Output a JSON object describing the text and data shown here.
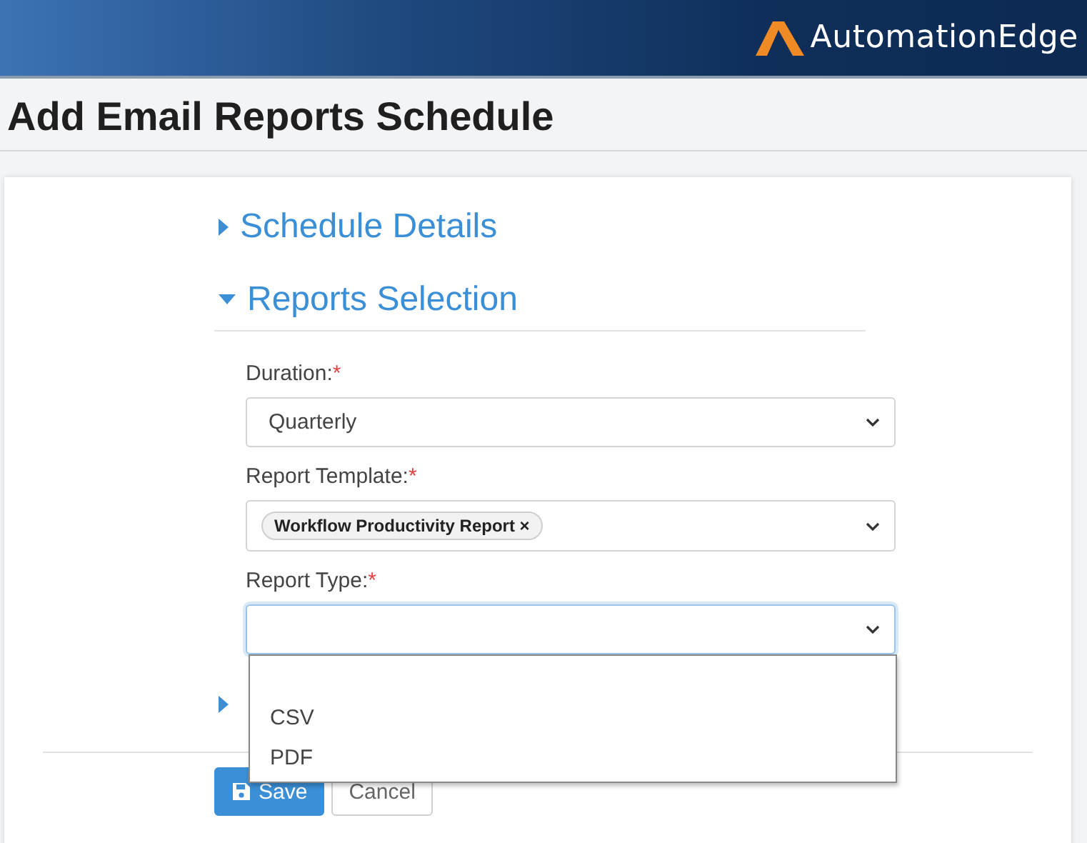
{
  "header": {
    "brand": "AutomationEdge"
  },
  "title": "Add Email Reports Schedule",
  "sections": [
    {
      "title": "Schedule Details",
      "expanded": false
    },
    {
      "title": "Reports Selection",
      "expanded": true,
      "fields": [
        {
          "kind": "select",
          "label": "Duration:",
          "required_mark": "*",
          "value": "Quarterly",
          "focused": false
        },
        {
          "kind": "multiselect",
          "label": "Report Template:",
          "required_mark": "*",
          "tags": [
            {
              "label": "Workflow Productivity Report",
              "remove": "×"
            }
          ]
        },
        {
          "kind": "select",
          "label": "Report Type:",
          "required_mark": "*",
          "focused": true,
          "open": true,
          "has_blank_option": true,
          "options": [
            {
              "label": "CSV",
              "selected": false
            },
            {
              "label": "PDF",
              "selected": false
            }
          ]
        }
      ]
    },
    {
      "expanded": false
    }
  ],
  "buttons": [
    {
      "kind": "primary",
      "label": "Save"
    },
    {
      "kind": "default",
      "label": "Cancel"
    }
  ]
}
